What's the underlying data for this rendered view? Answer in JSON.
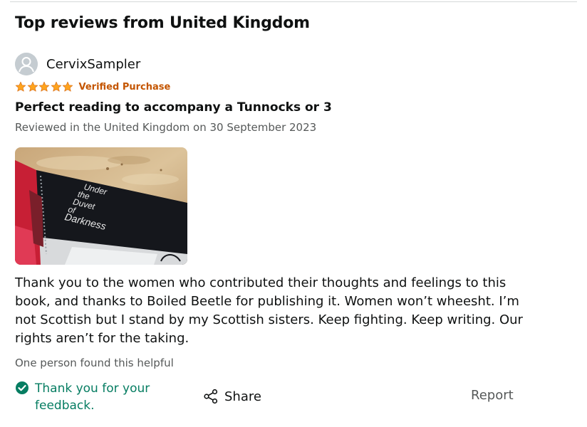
{
  "section": {
    "title": "Top reviews from United Kingdom"
  },
  "review": {
    "reviewer": {
      "name": "CervixSampler"
    },
    "rating": 5,
    "verified_label": "Verified Purchase",
    "title": "Perfect reading to accompany a Tunnocks or 3",
    "meta": "Reviewed in the United Kingdom on 30 September 2023",
    "image": {
      "cover_text": [
        "Under",
        "the",
        "Duvet",
        "of",
        "Darkness"
      ]
    },
    "body": "Thank you to the women who contributed their thoughts and feelings to this book, and thanks to Boiled Beetle for publishing it. Women won’t wheesht. I’m not Scottish but I stand by my Scottish sisters. Keep fighting. Keep writing. Our rights aren’t for the taking.",
    "helpful_count": "One person found this helpful",
    "feedback_text": "Thank you for your feedback.",
    "share_label": "Share",
    "report_label": "Report"
  },
  "colors": {
    "star": "#ffa41c",
    "verified": "#c45500",
    "feedback": "#067d62",
    "muted": "#565959"
  },
  "icons": {
    "avatar": "user-silhouette-icon",
    "star": "star-icon",
    "check": "check-circle-icon",
    "share": "share-icon"
  }
}
